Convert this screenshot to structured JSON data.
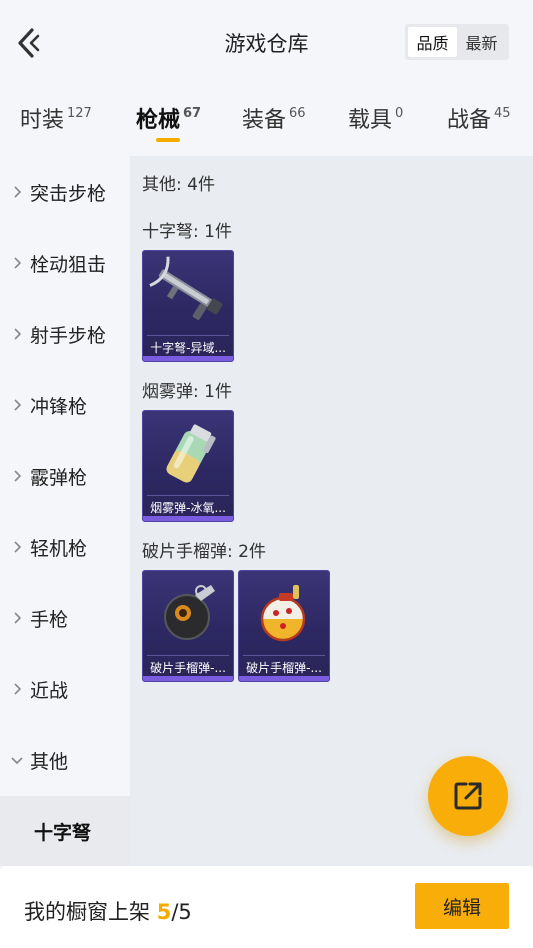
{
  "header": {
    "title": "游戏仓库",
    "sort_options": [
      "品质",
      "最新"
    ],
    "sort_active": "品质"
  },
  "tabs": [
    {
      "label": "时装",
      "count": "127"
    },
    {
      "label": "枪械",
      "count": "67"
    },
    {
      "label": "装备",
      "count": "66"
    },
    {
      "label": "载具",
      "count": "0"
    },
    {
      "label": "战备",
      "count": "45"
    }
  ],
  "sidebar": {
    "items": [
      "突击步枪",
      "栓动狙击",
      "射手步枪",
      "冲锋枪",
      "霰弹枪",
      "轻机枪",
      "手枪",
      "近战",
      "其他"
    ],
    "expanded": "其他",
    "sub_item": "十字弩"
  },
  "content": {
    "summary": "其他: 4件",
    "sections": [
      {
        "label": "十字弩: 1件",
        "cards": [
          "十字弩-异域..."
        ]
      },
      {
        "label": "烟雾弹: 1件",
        "cards": [
          "烟雾弹-冰氧..."
        ]
      },
      {
        "label": "破片手榴弹: 2件",
        "cards": [
          "破片手榴弹-...",
          "破片手榴弹-..."
        ]
      }
    ]
  },
  "bottom": {
    "showcase_label": "我的橱窗上架",
    "current": "5",
    "separator": "/",
    "total": "5",
    "edit_label": "编辑"
  },
  "colors": {
    "accent": "#f9ad09",
    "card_bg": "#2d2862",
    "card_bar": "#7a5ce0"
  },
  "icons": {
    "back": "chevron-left-icon",
    "fab": "external-link-icon",
    "side_chevron": "chevron-right-icon"
  }
}
